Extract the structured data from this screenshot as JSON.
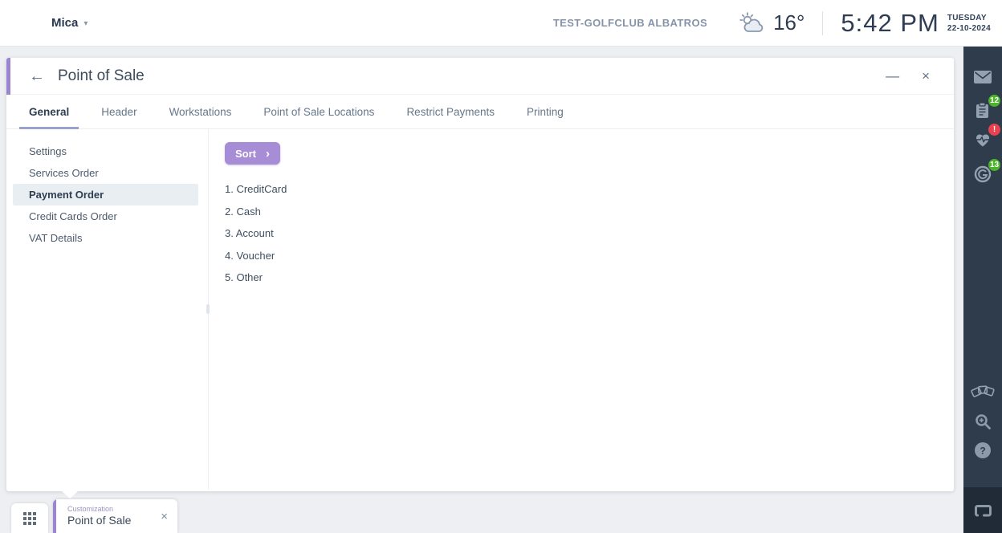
{
  "topbar": {
    "app_name": "Mica",
    "club_name": "TEST-GOLFCLUB ALBATROS",
    "temperature": "16°",
    "time": "5:42 PM",
    "weekday": "TUESDAY",
    "date": "22-10-2024"
  },
  "glyphs": {
    "caret_down": "▾",
    "back_arrow": "←",
    "minimize": "—",
    "close": "×",
    "sort_chevron": "›",
    "tab_close": "×"
  },
  "panel": {
    "title": "Point of Sale",
    "tabs": [
      {
        "label": "General",
        "active": true
      },
      {
        "label": "Header",
        "active": false
      },
      {
        "label": "Workstations",
        "active": false
      },
      {
        "label": "Point of Sale Locations",
        "active": false
      },
      {
        "label": "Restrict Payments",
        "active": false
      },
      {
        "label": "Printing",
        "active": false
      }
    ],
    "nav": [
      {
        "label": "Settings",
        "selected": false
      },
      {
        "label": "Services Order",
        "selected": false
      },
      {
        "label": "Payment Order",
        "selected": true
      },
      {
        "label": "Credit Cards Order",
        "selected": false
      },
      {
        "label": "VAT Details",
        "selected": false
      }
    ],
    "content": {
      "sort_label": "Sort",
      "payment_order": [
        "1. CreditCard",
        "2. Cash",
        "3. Account",
        "4. Voucher",
        "5. Other"
      ]
    }
  },
  "sidebar": {
    "badges": {
      "clipboard": "12",
      "heart": "!",
      "g_logo": "13"
    }
  },
  "taskbar": {
    "tab_category": "Customization",
    "tab_title": "Point of Sale"
  },
  "colors": {
    "accent_purple": "#9b84d0",
    "sort_button": "#a78cd6",
    "sidebar_bg": "#2f3c4b",
    "badge_green": "#4cb32b",
    "badge_red": "#e8414f",
    "selected_nav_bg": "#e9eef3"
  }
}
